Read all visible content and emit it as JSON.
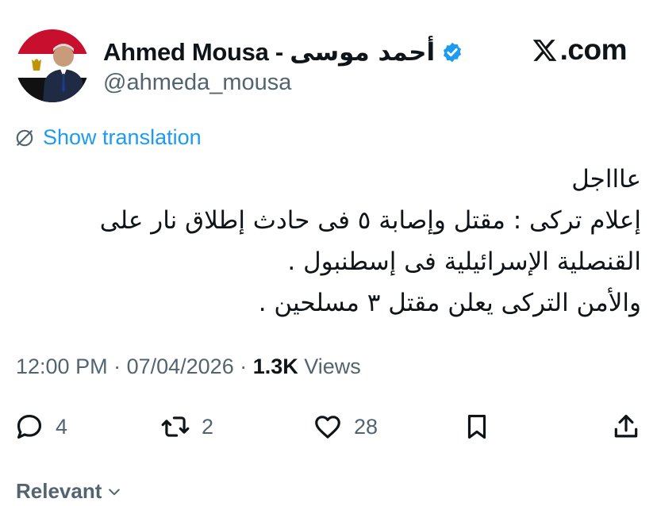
{
  "header": {
    "display_name_en": "Ahmed Mousa",
    "name_separator": " - ",
    "display_name_ar": "أحمد موسى",
    "handle": "@ahmeda_mousa",
    "brand": ".com"
  },
  "translate": {
    "label": "Show translation"
  },
  "tweet": {
    "lines": [
      "عاااجل",
      "إعلام تركى : مقتل وإصابة ٥ فى حادث إطلاق نار  على",
      "القنصلية الإسرائيلية فى إسطنبول .",
      "والأمن التركى يعلن مقتل ٣ مسلحين ."
    ]
  },
  "meta": {
    "time": "12:00 PM",
    "date": "07/04/2026",
    "separator": " · ",
    "views_count": "1.3K",
    "views_label": " Views"
  },
  "actions": {
    "replies": "4",
    "reposts": "2",
    "likes": "28"
  },
  "sort": {
    "label": "Relevant"
  },
  "colors": {
    "accent": "#1d9bf0",
    "text": "#0f1419",
    "secondary": "#536471"
  },
  "icons": [
    "verified-badge-icon",
    "x-logo-icon",
    "translate-icon",
    "reply-icon",
    "repost-icon",
    "like-icon",
    "bookmark-icon",
    "share-icon",
    "chevron-down-icon"
  ]
}
